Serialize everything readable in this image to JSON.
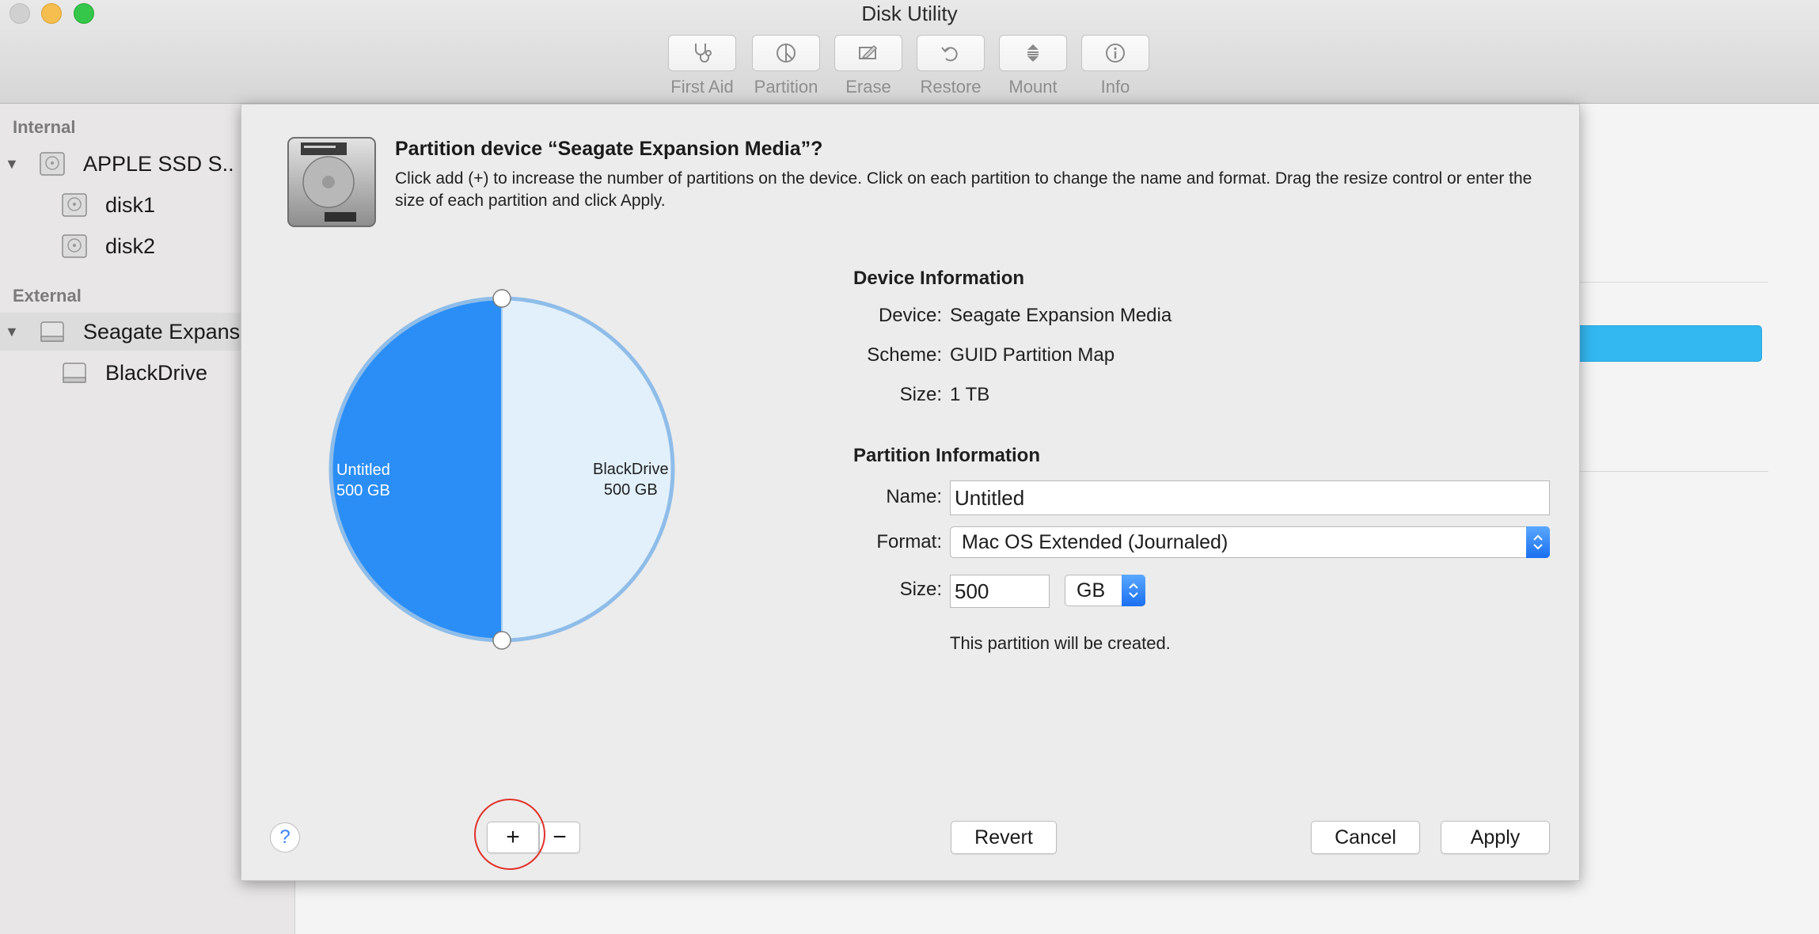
{
  "window": {
    "title": "Disk Utility"
  },
  "toolbar": {
    "items": [
      {
        "label": "First Aid",
        "icon": "stethoscope-icon"
      },
      {
        "label": "Partition",
        "icon": "partition-icon"
      },
      {
        "label": "Erase",
        "icon": "erase-icon"
      },
      {
        "label": "Restore",
        "icon": "restore-icon"
      },
      {
        "label": "Mount",
        "icon": "mount-icon"
      },
      {
        "label": "Info",
        "icon": "info-icon"
      }
    ]
  },
  "sidebar": {
    "internal_header": "Internal",
    "external_header": "External",
    "internal_items": [
      {
        "label": "APPLE SSD S...",
        "level": 0
      },
      {
        "label": "disk1",
        "level": 1
      },
      {
        "label": "disk2",
        "level": 1
      }
    ],
    "external_items": [
      {
        "label": "Seagate Expansi",
        "level": 0,
        "selected": true
      },
      {
        "label": "BlackDrive",
        "level": 1
      }
    ]
  },
  "sheet": {
    "title": "Partition device “Seagate Expansion Media”?",
    "description": "Click add (+) to increase the number of partitions on the device. Click on each partition to change the name and format. Drag the resize control or enter the size of each partition and click Apply.",
    "device_info": {
      "heading": "Device Information",
      "device_label": "Device:",
      "device_value": "Seagate Expansion Media",
      "scheme_label": "Scheme:",
      "scheme_value": "GUID Partition Map",
      "size_label": "Size:",
      "size_value": "1 TB"
    },
    "partition_info": {
      "heading": "Partition Information",
      "name_label": "Name:",
      "name_value": "Untitled",
      "format_label": "Format:",
      "format_value": "Mac OS Extended (Journaled)",
      "size_label": "Size:",
      "size_value": "500",
      "unit_value": "GB",
      "note": "This partition will be created."
    },
    "partitions": [
      {
        "name": "Untitled",
        "size": "500 GB",
        "fraction": 0.5,
        "color": "#2b8ef7",
        "selected": true
      },
      {
        "name": "BlackDrive",
        "size": "500 GB",
        "fraction": 0.5,
        "color": "#e2f0fb",
        "selected": false
      }
    ],
    "buttons": {
      "help": "?",
      "add": "+",
      "remove": "−",
      "revert": "Revert",
      "cancel": "Cancel",
      "apply": "Apply"
    }
  }
}
